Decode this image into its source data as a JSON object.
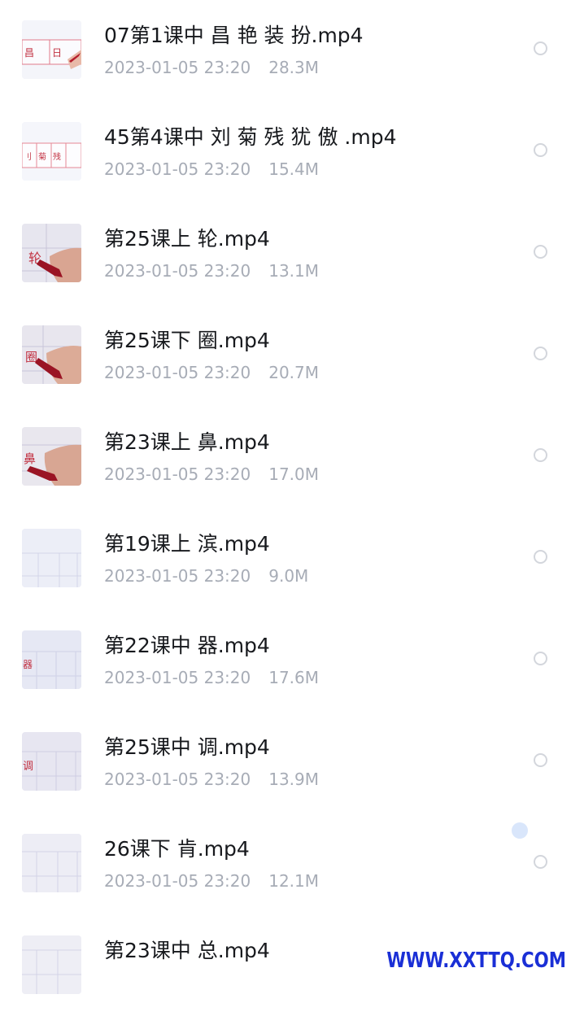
{
  "files": [
    {
      "name": "07第1课中 昌 艳 装 扮.mp4",
      "date": "2023-01-05 23:20",
      "size": "28.3M",
      "thumb": "red-writing"
    },
    {
      "name": "45第4课中 刘 菊 残 犹 傲 .mp4",
      "date": "2023-01-05 23:20",
      "size": "15.4M",
      "thumb": "red-writing"
    },
    {
      "name": "第25课上 轮.mp4",
      "date": "2023-01-05 23:20",
      "size": "13.1M",
      "thumb": "hand-pen"
    },
    {
      "name": "第25课下 圈.mp4",
      "date": "2023-01-05 23:20",
      "size": "20.7M",
      "thumb": "hand-pen"
    },
    {
      "name": "第23课上 鼻.mp4",
      "date": "2023-01-05 23:20",
      "size": "17.0M",
      "thumb": "hand-pen"
    },
    {
      "name": "第19课上 滨.mp4",
      "date": "2023-01-05 23:20",
      "size": "9.0M",
      "thumb": "grid"
    },
    {
      "name": "第22课中 器.mp4",
      "date": "2023-01-05 23:20",
      "size": "17.6M",
      "thumb": "grid-red"
    },
    {
      "name": "第25课中 调.mp4",
      "date": "2023-01-05 23:20",
      "size": "13.9M",
      "thumb": "grid-red"
    },
    {
      "name": "26课下 肯.mp4",
      "date": "2023-01-05 23:20",
      "size": "12.1M",
      "thumb": "grid"
    },
    {
      "name": "第23课中 总.mp4",
      "date": "",
      "size": "",
      "thumb": "grid"
    }
  ],
  "watermark": "WWW.XXTTQ.COM",
  "colors": {
    "title": "#17191d",
    "meta": "#a7acb6",
    "radio_border": "#d3d6dc",
    "watermark": "#1a2fd6"
  }
}
